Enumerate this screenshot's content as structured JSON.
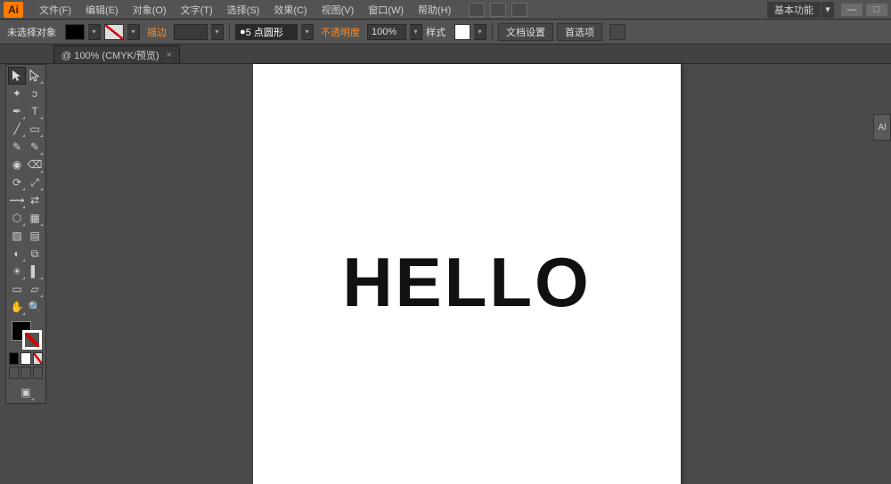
{
  "app": {
    "icon_text": "Ai"
  },
  "menu": {
    "items": [
      "文件(F)",
      "编辑(E)",
      "对象(O)",
      "文字(T)",
      "选择(S)",
      "效果(C)",
      "视图(V)",
      "窗口(W)",
      "帮助(H)"
    ]
  },
  "workspace_mode": {
    "label": "基本功能",
    "arrow": "▾"
  },
  "window_buttons": {
    "min": "—",
    "max": "□"
  },
  "control": {
    "no_selection": "未选择对象",
    "stroke_label": "描边",
    "stroke_weight_value": "",
    "brush_value": "5 点圆形",
    "opacity_label": "不透明度",
    "opacity_value": "100%",
    "style_label": "样式",
    "doc_setup": "文档设置",
    "prefs": "首选项",
    "arrow": "▾"
  },
  "doc_tab": {
    "label": "@ 100% (CMYK/预览)",
    "close": "×"
  },
  "canvas": {
    "text": "HELLO"
  },
  "right_panel": {
    "label": "Al"
  },
  "icons": {
    "selection": "▲",
    "direct": "▷",
    "wand": "✦",
    "lasso": "ɔ",
    "pen": "✒",
    "type": "T",
    "line": "╱",
    "rect": "▭",
    "brush": "✎",
    "pencil": "✎",
    "blob": "◉",
    "eraser": "⌫",
    "rotate": "⟳",
    "scale": "⤢",
    "width": "⟿",
    "free": "⇄",
    "shapeb": "⬡",
    "persp": "▦",
    "mesh": "▨",
    "grad": "▤",
    "eyedrop": "◐",
    "blend": "⧉",
    "symbol": "☀",
    "graph": "▌",
    "artb": "▭",
    "slice": "▱",
    "hand": "✋",
    "zoom": "🔍",
    "draw_normal": "◻",
    "draw_behind": "◻",
    "draw_inside": "◻",
    "screen": "▣"
  }
}
